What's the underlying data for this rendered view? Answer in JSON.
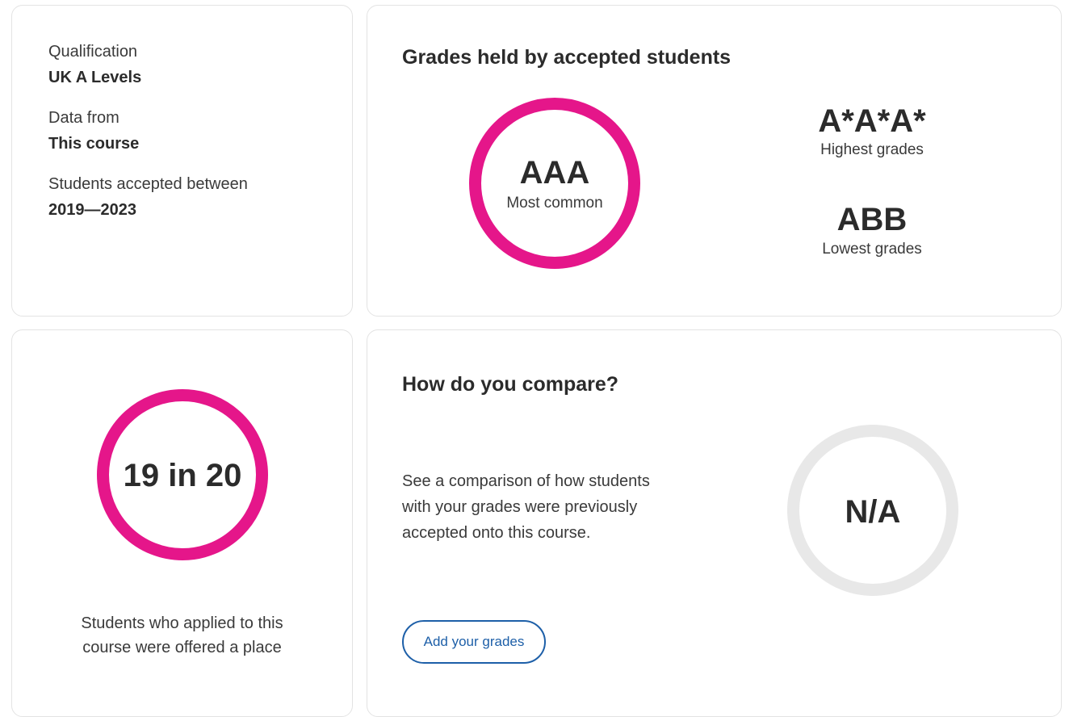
{
  "qualification": {
    "qualification_label": "Qualification",
    "qualification_value": "UK A Levels",
    "data_from_label": "Data from",
    "data_from_value": "This course",
    "accepted_label": "Students accepted between",
    "accepted_value": "2019—2023"
  },
  "grades": {
    "title": "Grades held by accepted students",
    "most_common_value": "AAA",
    "most_common_label": "Most common",
    "highest_value": "A*A*A*",
    "highest_label": "Highest grades",
    "lowest_value": "ABB",
    "lowest_label": "Lowest grades",
    "ring_color": "#e5168a"
  },
  "offers": {
    "ratio": "19 in 20",
    "description_line1": "Students who applied to this",
    "description_line2": "course were offered a place",
    "ring_color": "#e5168a"
  },
  "compare": {
    "title": "How do you compare?",
    "body_line1": "See a comparison of how students",
    "body_line2": "with your grades were previously",
    "body_line3": "accepted onto this course.",
    "result": "N/A",
    "button_label": "Add your grades",
    "ring_color": "#e8e8e8",
    "button_color": "#1d5fa8"
  }
}
